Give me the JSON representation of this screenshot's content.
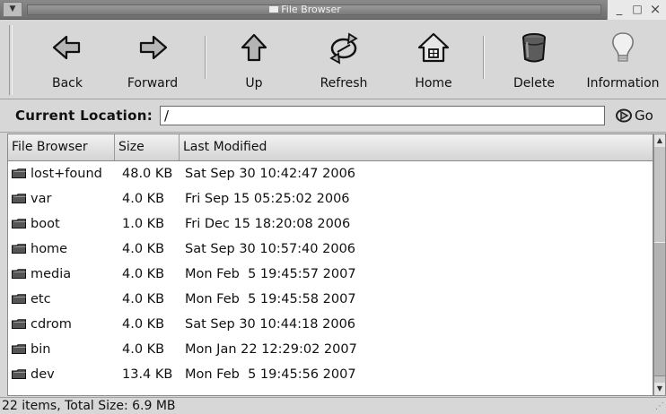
{
  "window": {
    "title": "File Browser",
    "menu_glyph": "▼",
    "controls": {
      "minimize": "_",
      "maximize": "□",
      "close": "×"
    }
  },
  "toolbar": {
    "buttons": [
      {
        "label": "Back",
        "icon": "arrow-left-icon"
      },
      {
        "label": "Forward",
        "icon": "arrow-right-icon"
      },
      {
        "label": "Up",
        "icon": "arrow-up-icon"
      },
      {
        "label": "Refresh",
        "icon": "refresh-icon"
      },
      {
        "label": "Home",
        "icon": "home-icon"
      },
      {
        "label": "Delete",
        "icon": "trash-icon"
      },
      {
        "label": "Information",
        "icon": "lightbulb-icon"
      }
    ]
  },
  "location": {
    "label": "Current Location:",
    "value": "/",
    "go_label": "Go"
  },
  "list": {
    "columns": [
      "File Browser",
      "Size",
      "Last Modified"
    ],
    "rows": [
      {
        "name": "lost+found",
        "size": "48.0 KB",
        "modified": "Sat Sep 30 10:42:47 2006"
      },
      {
        "name": "var",
        "size": "4.0 KB",
        "modified": "Fri Sep 15 05:25:02 2006"
      },
      {
        "name": "boot",
        "size": "1.0 KB",
        "modified": "Fri Dec 15 18:20:08 2006"
      },
      {
        "name": "home",
        "size": "4.0 KB",
        "modified": "Sat Sep 30 10:57:40 2006"
      },
      {
        "name": "media",
        "size": "4.0 KB",
        "modified": "Mon Feb  5 19:45:57 2007"
      },
      {
        "name": "etc",
        "size": "4.0 KB",
        "modified": "Mon Feb  5 19:45:58 2007"
      },
      {
        "name": "cdrom",
        "size": "4.0 KB",
        "modified": "Sat Sep 30 10:44:18 2006"
      },
      {
        "name": "bin",
        "size": "4.0 KB",
        "modified": "Mon Jan 22 12:29:02 2007"
      },
      {
        "name": "dev",
        "size": "13.4 KB",
        "modified": "Mon Feb  5 19:45:56 2007"
      }
    ]
  },
  "status": {
    "text": "22 items, Total Size: 6.9 MB"
  },
  "scrollbar": {
    "up": "▲",
    "down": "▼"
  }
}
